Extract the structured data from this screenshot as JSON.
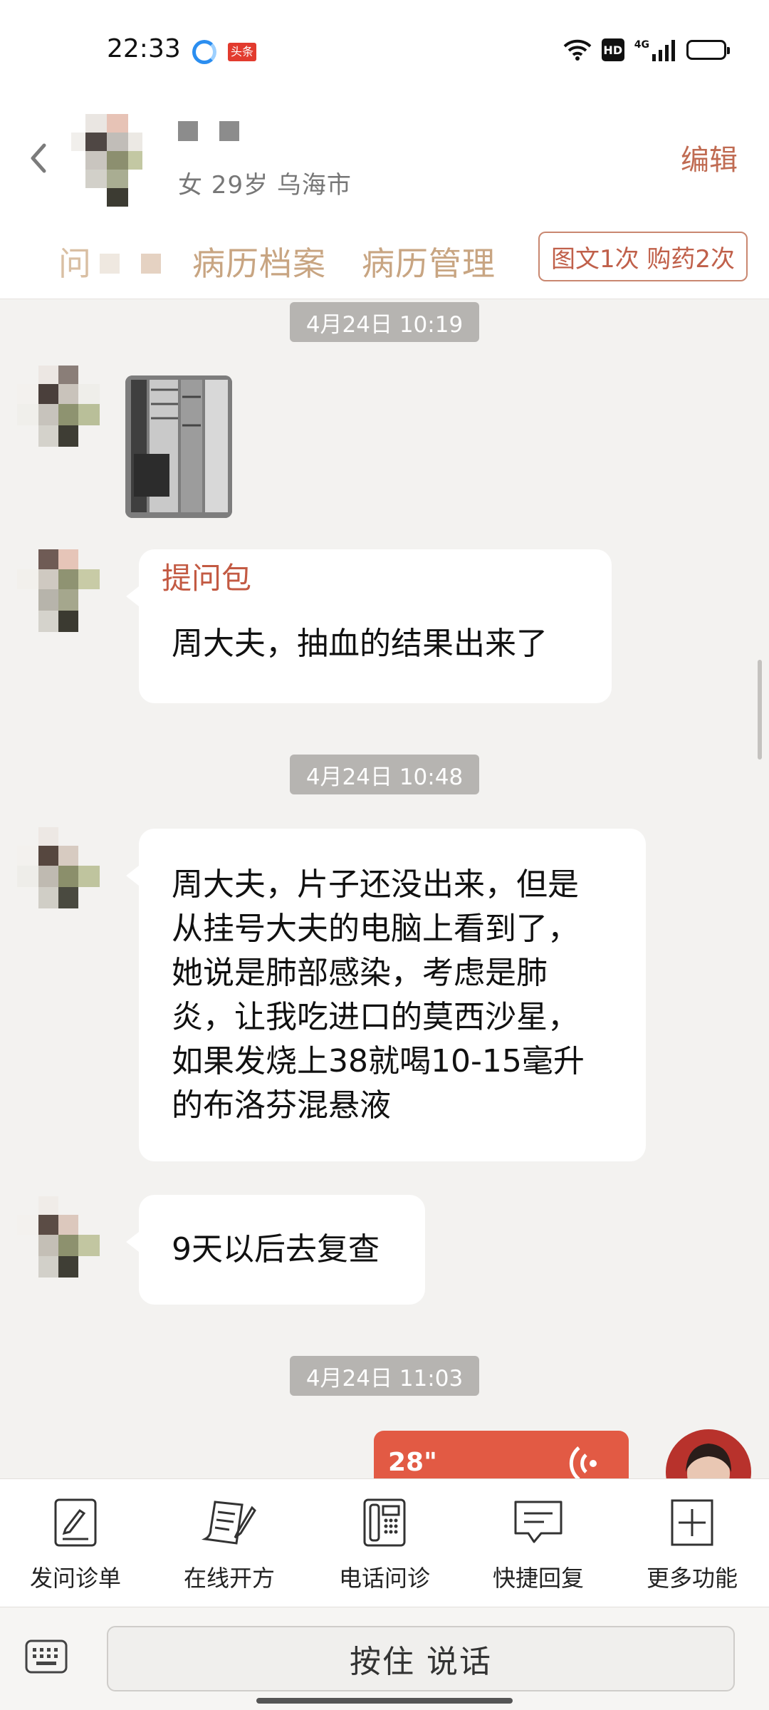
{
  "status_bar": {
    "time": "22:33",
    "app_badge": "头条",
    "hd": "HD",
    "network": "4G"
  },
  "header": {
    "patient_info": "女 29岁  乌海市",
    "edit_label": "编辑",
    "tabs": [
      {
        "label": "问"
      },
      {
        "label": "病历档案"
      },
      {
        "label": "病历管理"
      }
    ],
    "order_badge": "图文1次 购药2次"
  },
  "chat": {
    "timestamps": [
      "4月24日 10:19",
      "4月24日 10:48",
      "4月24日 11:03"
    ],
    "question_pack": {
      "title": "提问包",
      "text": "周大夫，抽血的结果出来了"
    },
    "message_long": [
      "周大夫，片子还没出来，但是",
      "从挂号大夫的电脑上看到了，",
      "她说是肺部感染，考虑是肺",
      "炎，让我吃进口的莫西沙星，",
      "如果发烧上38就喝10-15毫升",
      "的布洛芬混悬液"
    ],
    "message_short": "9天以后去复查",
    "voice": {
      "duration": "28\""
    }
  },
  "toolbar": {
    "items": [
      {
        "label": "发问诊单",
        "icon": "form-edit-icon"
      },
      {
        "label": "在线开方",
        "icon": "prescription-icon"
      },
      {
        "label": "电话问诊",
        "icon": "phone-icon"
      },
      {
        "label": "快捷回复",
        "icon": "quick-reply-icon"
      },
      {
        "label": "更多功能",
        "icon": "plus-icon"
      }
    ]
  },
  "input": {
    "talk_label": "按住 说话"
  },
  "colors": {
    "accent": "#c35a43",
    "voice_bubble": "#e25a44",
    "tab_text": "#c8a582",
    "timestamp_bg": "#b6b4b1"
  }
}
